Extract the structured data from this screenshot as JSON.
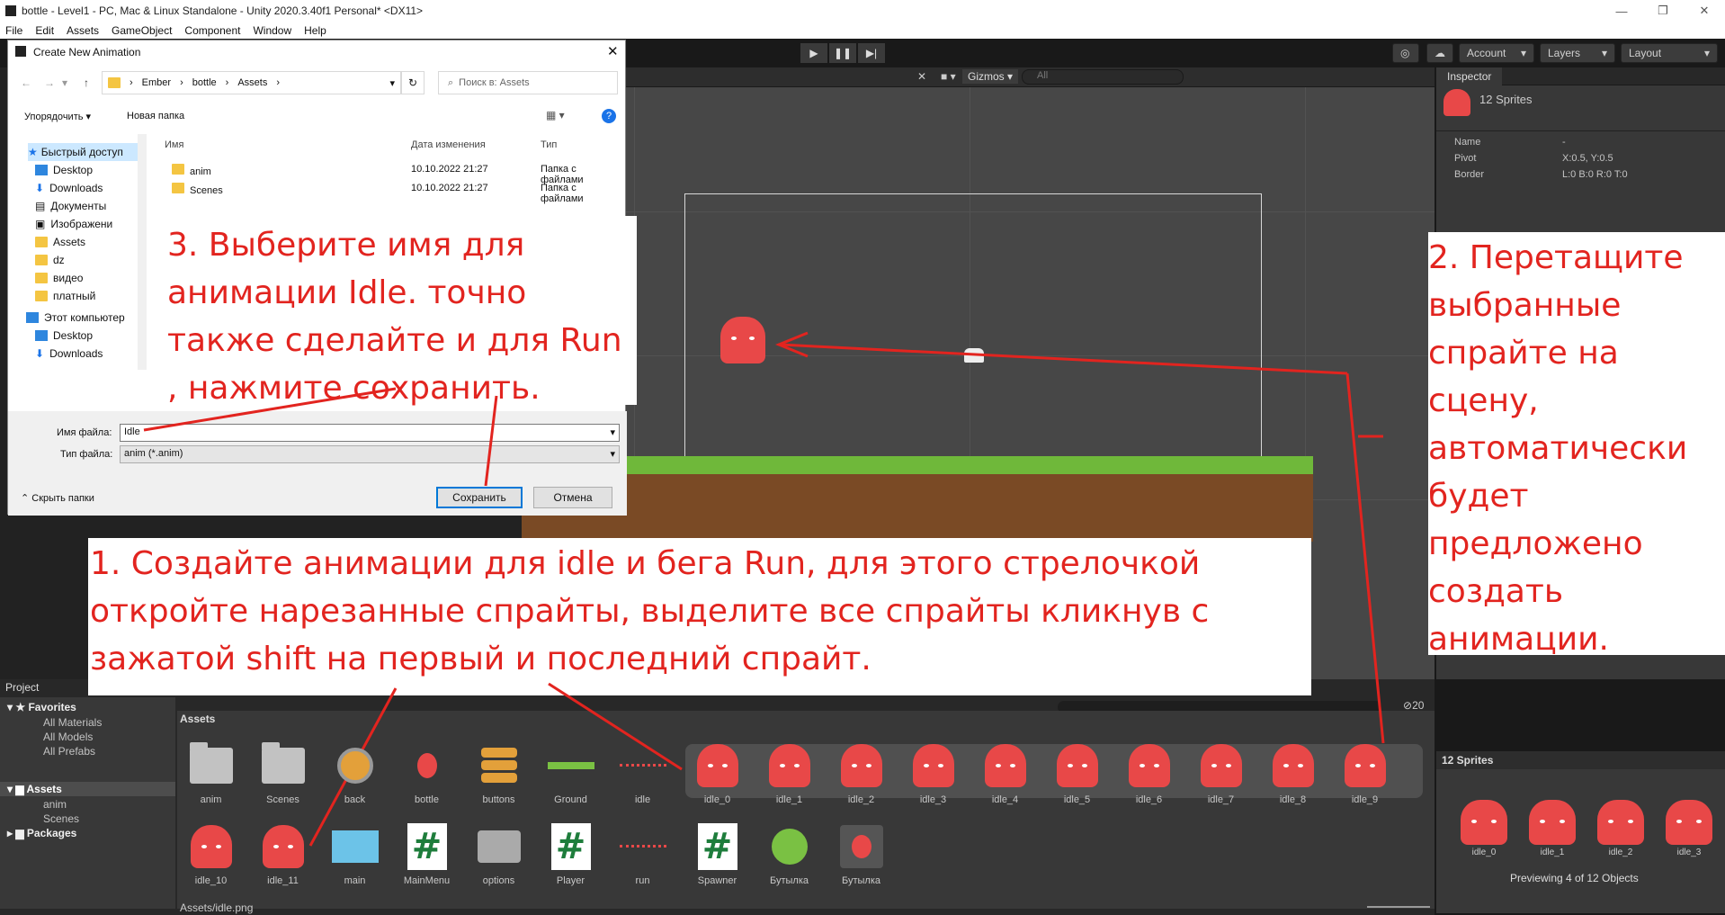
{
  "titlebar": {
    "title": "bottle - Level1 - PC, Mac & Linux Standalone - Unity 2020.3.40f1 Personal* <DX11>"
  },
  "menu": [
    "File",
    "Edit",
    "Assets",
    "GameObject",
    "Component",
    "Window",
    "Help"
  ],
  "toolbar": {
    "account": "Account",
    "layers": "Layers",
    "layout": "Layout"
  },
  "scene": {
    "gizmos": "Gizmos",
    "search_placeholder": "All",
    "hidden_count": "0"
  },
  "inspector": {
    "tab": "Inspector",
    "object": "12 Sprites",
    "name_label": "Name",
    "name_value": "-",
    "pivot_label": "Pivot",
    "pivot_value": "X:0.5, Y:0.5",
    "border_label": "Border",
    "border_value": "L:0 B:0 R:0 T:0"
  },
  "dialog": {
    "title": "Create New Animation",
    "breadcrumb": [
      "Ember",
      "bottle",
      "Assets"
    ],
    "search_placeholder": "Поиск в: Assets",
    "organize": "Упорядочить",
    "new_folder": "Новая папка",
    "col_name": "Имя",
    "col_date": "Дата изменения",
    "col_type": "Тип",
    "files": [
      {
        "name": "anim",
        "date": "10.10.2022 21:27",
        "type": "Папка с файлами"
      },
      {
        "name": "Scenes",
        "date": "10.10.2022 21:27",
        "type": "Папка с файлами"
      }
    ],
    "sidebar": [
      "Быстрый доступ",
      "Desktop",
      "Downloads",
      "Документы",
      "Изображени",
      "Assets",
      "dz",
      "видео",
      "платный",
      "Этот компьютер",
      "Desktop",
      "Downloads"
    ],
    "filename_label": "Имя файла:",
    "filename_value": "Idle",
    "filetype_label": "Тип файла:",
    "filetype_value": "anim (*.anim)",
    "hide_folders": "Скрыть папки",
    "save": "Сохранить",
    "cancel": "Отмена"
  },
  "project": {
    "tab": "Project",
    "favorites": "Favorites",
    "fav_items": [
      "All Materials",
      "All Models",
      "All Prefabs"
    ],
    "assets": "Assets",
    "asset_children": [
      "anim",
      "Scenes"
    ],
    "packages": "Packages",
    "header": "Assets",
    "hidden_count": "20",
    "status": "Assets/idle.png",
    "row1": [
      "anim",
      "Scenes",
      "back",
      "bottle",
      "buttons",
      "Ground",
      "idle",
      "idle_0",
      "idle_1",
      "idle_2",
      "idle_3",
      "idle_4",
      "idle_5",
      "idle_6",
      "idle_7",
      "idle_8",
      "idle_9"
    ],
    "row2": [
      "idle_10",
      "idle_11",
      "main",
      "MainMenu",
      "options",
      "Player",
      "run",
      "Spawner",
      "Бутылка",
      "Бутылка"
    ]
  },
  "preview": {
    "title": "12 Sprites",
    "items": [
      "idle_0",
      "idle_1",
      "idle_2",
      "idle_3"
    ],
    "status": "Previewing 4 of 12 Objects"
  },
  "annotations": {
    "step1": "1. Создайте анимации для idle и бега Run, для этого стрелочкой откройте нарезанные спрайты, выделите все спрайты кликнув с зажатой shift на первый и последний спрайт.",
    "step2": "2. Перетащите выбранные спрайте на сцену, автоматически будет предложено создать анимации.",
    "step3": "3. Выберите имя для анимации Idle. точно также сделайте и для Run , нажмите сохранить."
  },
  "colors": {
    "annotation": "#e2241f",
    "sprite": "#e84848"
  }
}
